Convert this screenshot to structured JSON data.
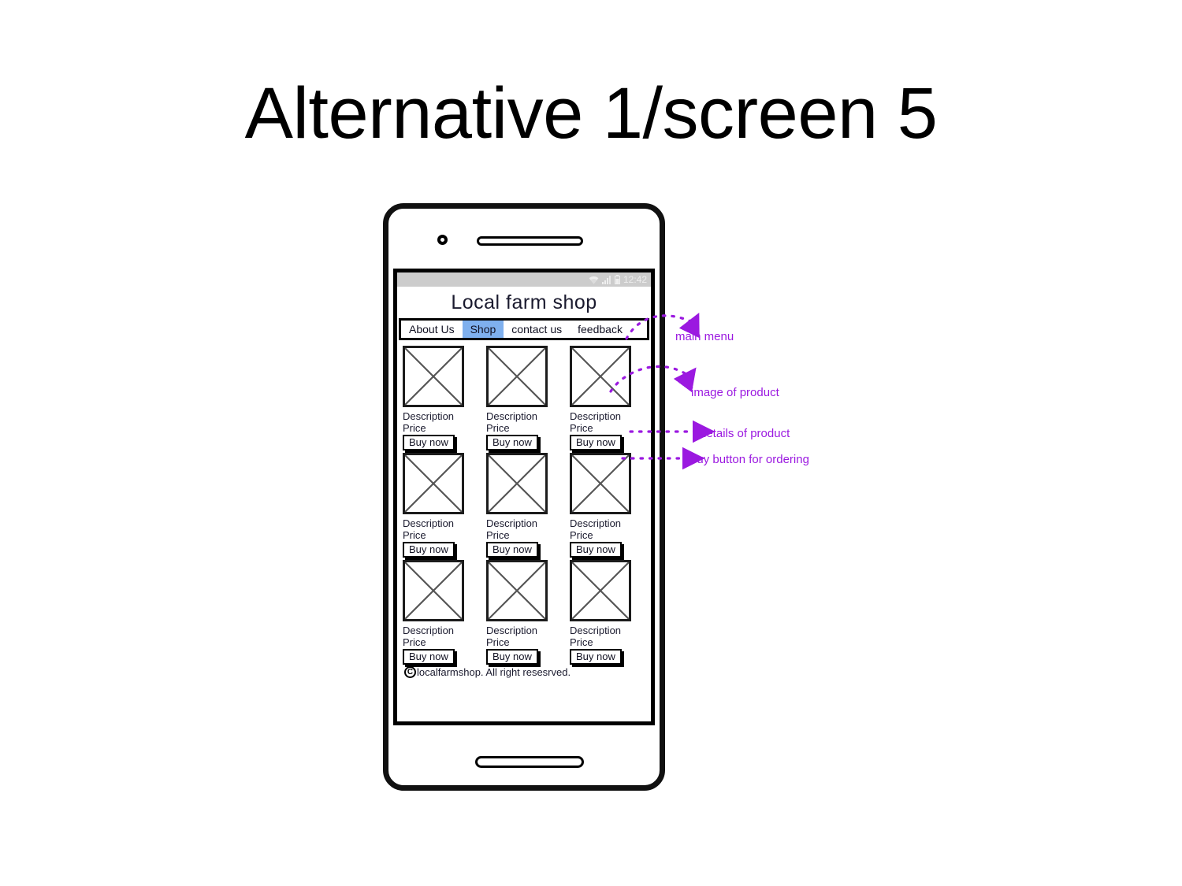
{
  "slide": {
    "title": "Alternative 1/screen 5"
  },
  "colors": {
    "accent_purple": "#9b19e0",
    "active_tab": "#7fb0ee",
    "statusbar": "#cccccc",
    "frame": "#111111"
  },
  "phone": {
    "camera_icon": "camera-dot",
    "speaker_icon": "speaker-grille",
    "home_icon": "home-button"
  },
  "statusbar": {
    "wifi_icon": "wifi-icon",
    "signal_icon": "signal-bars-icon",
    "battery_icon": "battery-icon",
    "time": "12:42"
  },
  "app": {
    "title": "Local farm shop",
    "nav": [
      {
        "label": "About Us",
        "active": false
      },
      {
        "label": "Shop",
        "active": true
      },
      {
        "label": "contact us",
        "active": false
      },
      {
        "label": "feedback",
        "active": false
      }
    ],
    "products": [
      {
        "image_placeholder": "image-placeholder-x",
        "description": "Description",
        "price": "Price",
        "buy_label": "Buy now"
      },
      {
        "image_placeholder": "image-placeholder-x",
        "description": "Description",
        "price": "Price",
        "buy_label": "Buy now"
      },
      {
        "image_placeholder": "image-placeholder-x",
        "description": "Description",
        "price": "Price",
        "buy_label": "Buy now"
      },
      {
        "image_placeholder": "image-placeholder-x",
        "description": "Description",
        "price": "Price",
        "buy_label": "Buy now"
      },
      {
        "image_placeholder": "image-placeholder-x",
        "description": "Description",
        "price": "Price",
        "buy_label": "Buy now"
      },
      {
        "image_placeholder": "image-placeholder-x",
        "description": "Description",
        "price": "Price",
        "buy_label": "Buy now"
      },
      {
        "image_placeholder": "image-placeholder-x",
        "description": "Description",
        "price": "Price",
        "buy_label": "Buy now"
      },
      {
        "image_placeholder": "image-placeholder-x",
        "description": "Description",
        "price": "Price",
        "buy_label": "Buy now"
      },
      {
        "image_placeholder": "image-placeholder-x",
        "description": "Description",
        "price": "Price",
        "buy_label": "Buy now"
      }
    ],
    "footer": {
      "copyright_symbol": "C",
      "text": "localfarmshop. All right resesrved."
    }
  },
  "annotations": [
    {
      "id": "main-menu",
      "label": "main menu"
    },
    {
      "id": "image-of-product",
      "label": "image of product"
    },
    {
      "id": "details-of-product",
      "label": "details of product"
    },
    {
      "id": "buy-button",
      "label": "buy button for ordering"
    }
  ]
}
